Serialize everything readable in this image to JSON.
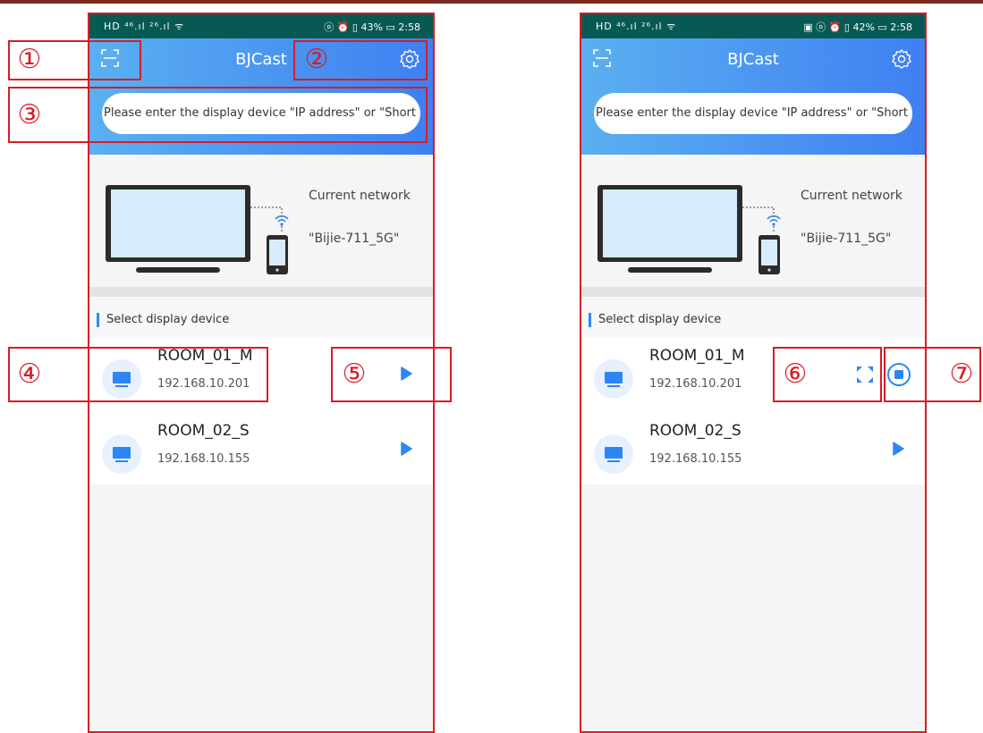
{
  "screens": [
    {
      "status": {
        "left": "HD ⁴⁶.ıl ²⁶.ıl ᯤ",
        "right": "ⓞ ⏰ ▯ 43% ▭ 2:58"
      },
      "app_title": "BJCast",
      "search_placeholder": "Please enter the display device \"IP address\" or \"Short",
      "network_label": "Current network",
      "network_name": "\"Bijie-711_5G\"",
      "section_label": "Select display device",
      "devices": [
        {
          "name": "ROOM_01_M",
          "ip": "192.168.10.201",
          "state": "idle"
        },
        {
          "name": "ROOM_02_S",
          "ip": "192.168.10.155",
          "state": "idle"
        }
      ]
    },
    {
      "status": {
        "left": "HD ⁴⁶.ıl ²⁶.ıl ᯤ",
        "right": "▣ ⓞ ⏰ ▯ 42% ▭ 2:58"
      },
      "app_title": "BJCast",
      "search_placeholder": "Please enter the display device \"IP address\" or \"Short",
      "network_label": "Current network",
      "network_name": "\"Bijie-711_5G\"",
      "section_label": "Select display device",
      "devices": [
        {
          "name": "ROOM_01_M",
          "ip": "192.168.10.201",
          "state": "casting"
        },
        {
          "name": "ROOM_02_S",
          "ip": "192.168.10.155",
          "state": "idle"
        }
      ]
    }
  ],
  "annotations": [
    "①",
    "②",
    "③",
    "④",
    "⑤",
    "⑥",
    "⑦"
  ],
  "colors": {
    "accent": "#2e86f5",
    "annotation": "#d91c24",
    "status_bar": "#075a54"
  }
}
